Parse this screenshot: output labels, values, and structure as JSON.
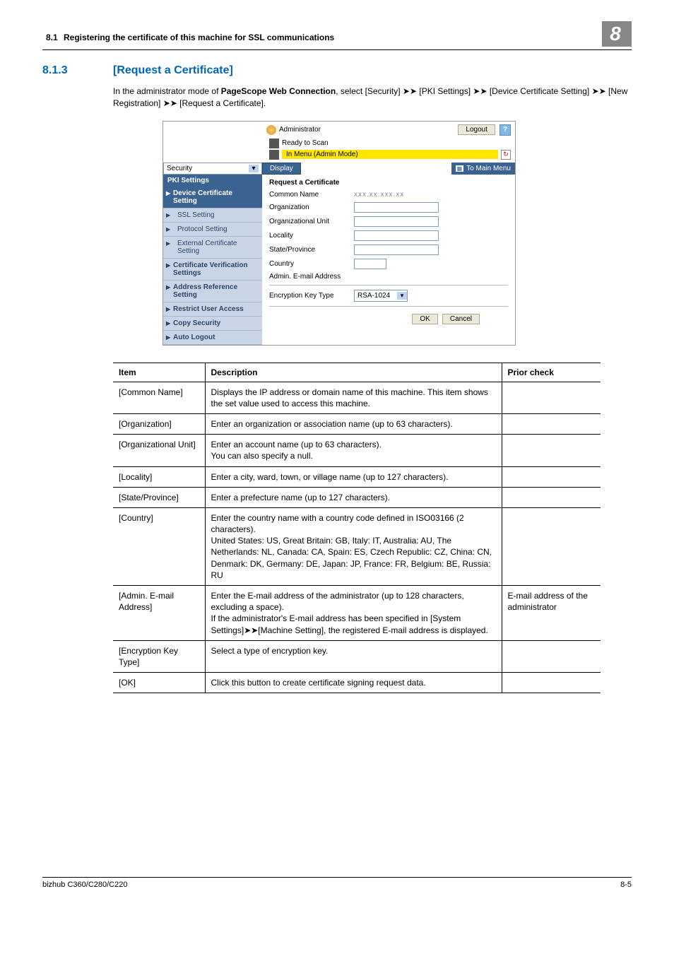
{
  "header": {
    "num": "8.1",
    "title": "Registering the certificate of this machine for SSL communications",
    "chapter": "8"
  },
  "section": {
    "num": "8.1.3",
    "title": "[Request a Certificate]"
  },
  "intro": {
    "p1a": "In the administrator mode of ",
    "p1b": "PageScope Web Connection",
    "p1c": ", select [Security] ",
    "arrow": "➤➤",
    "p1d": " [PKI Settings] ",
    "p1e": " [Device Certificate Setting] ",
    "p1f": " [New Registration] ",
    "p1g": " [Request a Certificate]."
  },
  "shot": {
    "administrator": "Administrator",
    "logout": "Logout",
    "help": "?",
    "ready": "Ready to Scan",
    "mode": "In Menu (Admin Mode)",
    "security": "Security",
    "display": "Display",
    "toMain": "To Main Menu",
    "nav": {
      "pki": "PKI Settings",
      "dev": "Device Certificate Setting",
      "ssl": "SSL Setting",
      "proto": "Protocol Setting",
      "ext": "External Certificate Setting",
      "cvs": "Certificate Verification Settings",
      "ars": "Address Reference Setting",
      "rua": "Restrict User Access",
      "cs": "Copy Security",
      "al": "Auto Logout"
    },
    "form": {
      "title": "Request a Certificate",
      "cn": "Common Name",
      "cn_val": "xxx.xx.xxx.xx",
      "org": "Organization",
      "ou": "Organizational Unit",
      "loc": "Locality",
      "sp": "State/Province",
      "ctry": "Country",
      "email": "Admin. E-mail Address",
      "ekt": "Encryption Key Type",
      "ekt_val": "RSA-1024",
      "ok": "OK",
      "cancel": "Cancel"
    }
  },
  "table": {
    "h1": "Item",
    "h2": "Description",
    "h3": "Prior check",
    "rows": [
      {
        "item": "[Common Name]",
        "desc": "Displays the IP address or domain name of this machine. This item shows the set value used to access this machine.",
        "prior": ""
      },
      {
        "item": "[Organization]",
        "desc": "Enter an organization or association name (up to 63 characters).",
        "prior": ""
      },
      {
        "item": "[Organizational Unit]",
        "desc": "Enter an account name (up to 63 characters).\nYou can also specify a null.",
        "prior": ""
      },
      {
        "item": "[Locality]",
        "desc": "Enter a city, ward, town, or village name (up to 127 characters).",
        "prior": ""
      },
      {
        "item": "[State/Province]",
        "desc": "Enter a prefecture name (up to 127 characters).",
        "prior": ""
      },
      {
        "item": "[Country]",
        "desc": "Enter the country name with a country code defined in ISO03166 (2 characters).\nUnited States: US, Great Britain: GB, Italy: IT, Australia: AU, The Netherlands: NL, Canada: CA, Spain: ES, Czech Republic: CZ, China: CN, Denmark: DK, Germany: DE, Japan: JP, France: FR, Belgium: BE, Russia: RU",
        "prior": ""
      },
      {
        "item": "[Admin. E-mail Address]",
        "desc": "Enter the E-mail address of the administrator (up to 128 characters, excluding a space).\nIf the administrator's E-mail address has been specified in [System Settings]➤➤[Machine Setting], the registered E-mail address is displayed.",
        "prior": "E-mail address of the administrator"
      },
      {
        "item": "[Encryption Key Type]",
        "desc": "Select a type of encryption key.",
        "prior": ""
      },
      {
        "item": "[OK]",
        "desc": "Click this button to create certificate signing request data.",
        "prior": ""
      }
    ]
  },
  "footer": {
    "left": "bizhub C360/C280/C220",
    "right": "8-5"
  }
}
